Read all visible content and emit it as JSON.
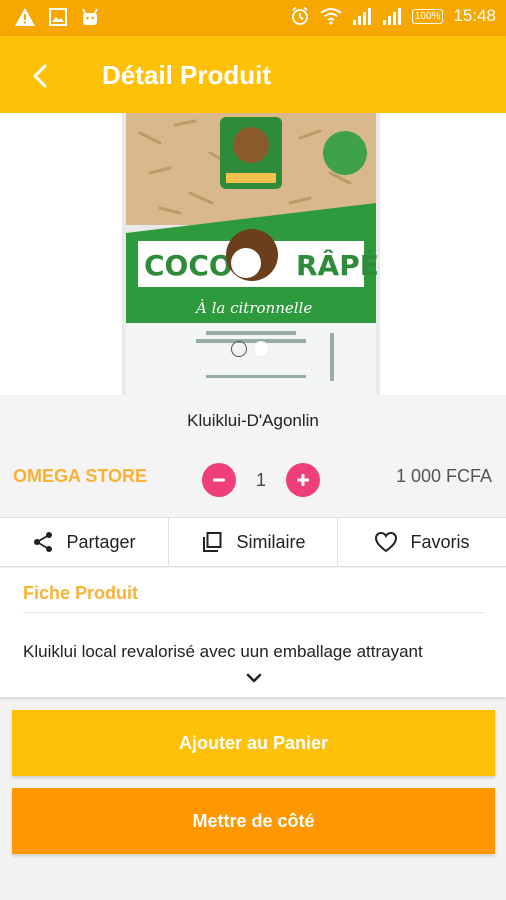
{
  "status_bar": {
    "time": "15:48",
    "battery": "100%",
    "colors": {
      "background": "#f7a800"
    }
  },
  "app_bar": {
    "title": "Détail Produit",
    "back_icon": "arrow-back-icon",
    "colors": {
      "background": "#ffc107"
    }
  },
  "product": {
    "image_icon": "product-photo",
    "carousel": {
      "count": 2,
      "active_index": 1
    },
    "name": "Kluiklui-D'Agonlin",
    "store": "OMEGA STORE",
    "quantity": "1",
    "price": "1 000 FCFA",
    "colors": {
      "store": "#f9b233",
      "qty_buttons": "#ee3e7b"
    }
  },
  "actions": [
    {
      "label": "Partager",
      "icon": "share-icon"
    },
    {
      "label": "Similaire",
      "icon": "copy-icon"
    },
    {
      "label": "Favoris",
      "icon": "heart-icon"
    }
  ],
  "fiche": {
    "title": "Fiche Produit",
    "description": "Kluiklui local revalorisé avec uun emballage attrayant"
  },
  "buttons": {
    "add_to_cart": "Ajouter au Panier",
    "put_aside": "Mettre de côté",
    "colors": {
      "add_to_cart": "#ffc107",
      "put_aside": "#ff9800"
    }
  }
}
